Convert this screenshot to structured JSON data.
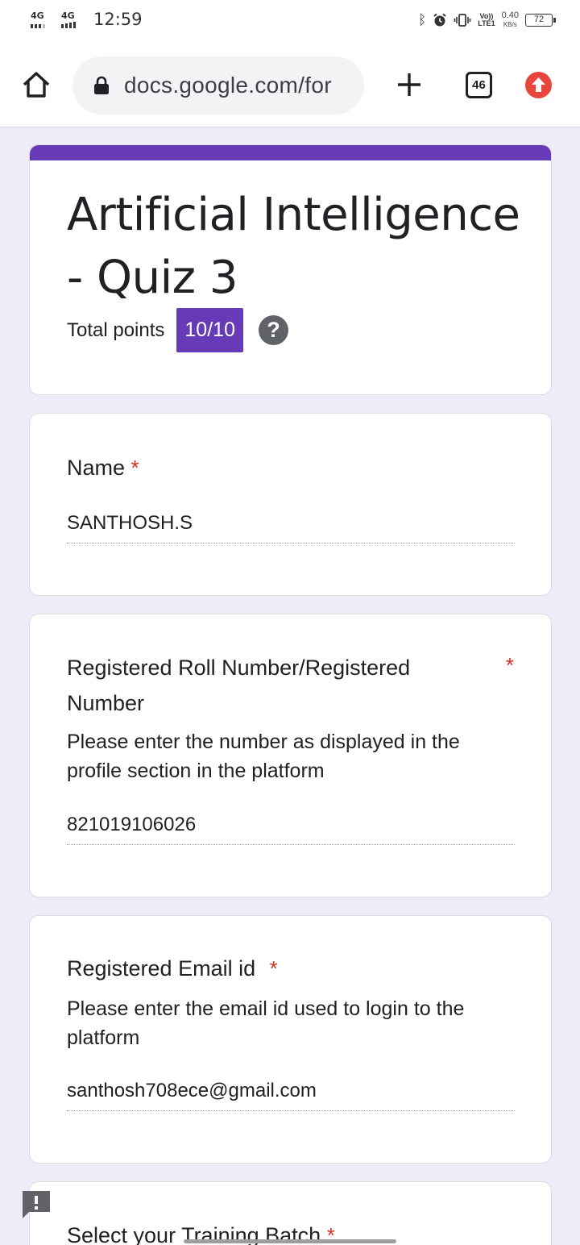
{
  "status_bar": {
    "sim1": "4G",
    "sim2": "4G",
    "time": "12:59",
    "volte_top": "Vo))",
    "volte_bottom": "LTE1",
    "speed_value": "0.40",
    "speed_unit": "KB/s",
    "battery": "72"
  },
  "browser": {
    "url": "docs.google.com/for",
    "tab_count": "46"
  },
  "form": {
    "title": "Artificial Intelligence - Quiz 3",
    "points_label": "Total points",
    "score": "10/10",
    "help_symbol": "?"
  },
  "questions": [
    {
      "label": "Name",
      "required_mark": "*",
      "answer": "SANTHOSH.S"
    },
    {
      "label": "Registered Roll Number/Registered Number",
      "required_mark": "*",
      "description": "Please enter the number as displayed in the profile section in the platform",
      "answer": "821019106026"
    },
    {
      "label": "Registered Email id",
      "required_mark": "*",
      "description": "Please enter the email id used to login to the platform",
      "answer": "santhosh708ece@gmail.com"
    },
    {
      "label": "Select your Training Batch",
      "required_mark": "*"
    }
  ],
  "colors": {
    "accent": "#673ab7",
    "required": "#d93025",
    "page_background": "#f0ebf8",
    "update_badge": "#e8453c"
  },
  "icons": [
    "home-icon",
    "lock-icon",
    "plus-icon",
    "tab-count-icon",
    "update-icon",
    "help-icon",
    "feedback-icon",
    "bluetooth-icon",
    "alarm-icon",
    "vibrate-icon"
  ]
}
